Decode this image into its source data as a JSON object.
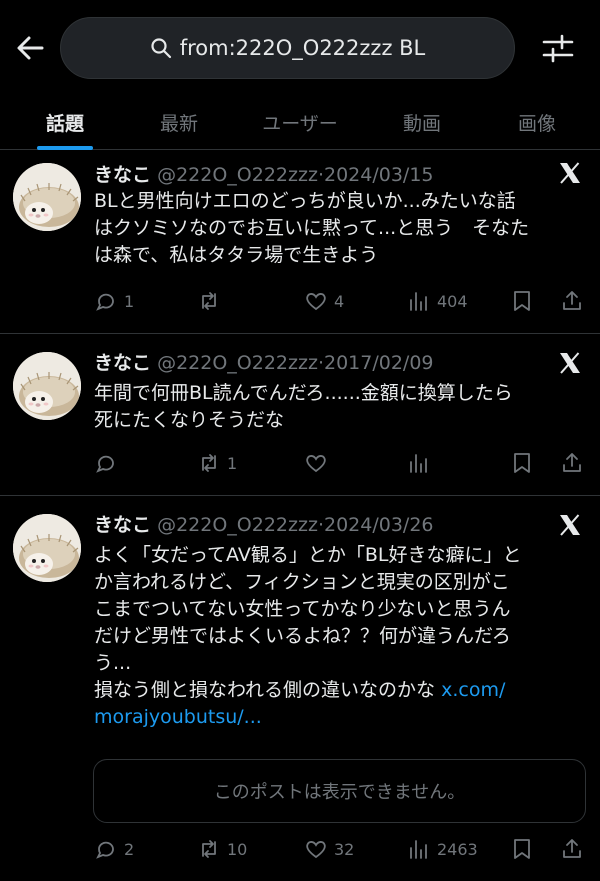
{
  "search": {
    "query": "from:222O_O222zzz BL"
  },
  "tabs": [
    {
      "label": "話題",
      "active": true
    },
    {
      "label": "最新"
    },
    {
      "label": "ユーザー"
    },
    {
      "label": "動画"
    },
    {
      "label": "画像"
    }
  ],
  "colors": {
    "accent": "#1d9bf0",
    "muted": "#71767b",
    "text": "#e7e9ea",
    "background": "#000000"
  },
  "posts": [
    {
      "name": "きなこ",
      "handle": "@222O_O222zzz",
      "date": "2024/03/15",
      "text": "BLと男性向けエロのどっちが良いか...みたいな話\nはクソミソなのでお互いに黙って...と思う　そなた\nは森で、私はタタラ場で生きよう",
      "replies": "1",
      "reposts": "",
      "likes": "4",
      "views": "404"
    },
    {
      "name": "きなこ",
      "handle": "@222O_O222zzz",
      "date": "2017/02/09",
      "text": "年間で何冊BL読んでんだろ......金額に換算したら\n死にたくなりそうだな",
      "replies": "",
      "reposts": "1",
      "likes": "",
      "views": ""
    },
    {
      "name": "きなこ",
      "handle": "@222O_O222zzz",
      "date": "2024/03/26",
      "text": "よく「女だってAV観る」とか「BL好きな癖に」と\nか言われるけど、フィクションと現実の区別がこ\nこまでついてない女性ってかなり少ないと思うん\nだけど男性ではよくいるよね？？何が違うんだろ\nう...\n損なう側と損なわれる側の違いなのかな ",
      "link_text": "x.com/\nmorajyoubutsu/...",
      "quote_unavailable": "このポストは表示できません。",
      "replies": "2",
      "reposts": "10",
      "likes": "32",
      "views": "2463"
    }
  ],
  "separator": "·"
}
